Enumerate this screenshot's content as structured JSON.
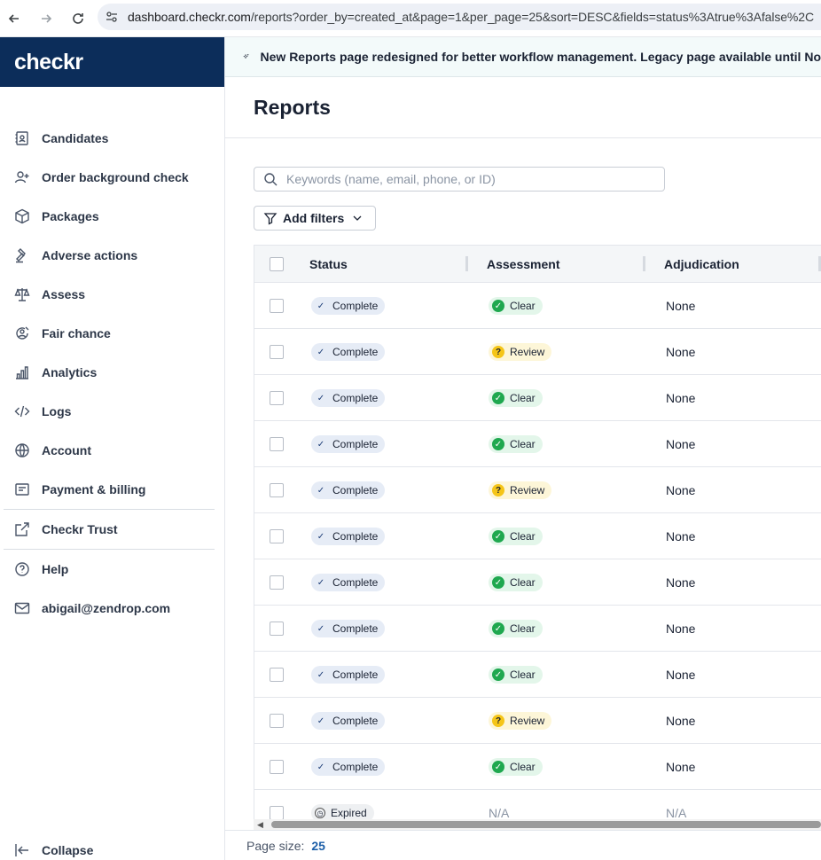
{
  "browser": {
    "url_domain": "dashboard.checkr.com",
    "url_path": "/reports?order_by=created_at&page=1&per_page=25&sort=DESC&fields=status%3Atrue%3Afalse%2C"
  },
  "brand": {
    "logo_text": "checkr",
    "color": "#0c2d5a"
  },
  "sidebar": {
    "items": [
      {
        "label": "Candidates",
        "icon": "contact-book-icon"
      },
      {
        "label": "Order background check",
        "icon": "add-user-icon"
      },
      {
        "label": "Packages",
        "icon": "package-box-icon"
      },
      {
        "label": "Adverse actions",
        "icon": "gavel-icon"
      },
      {
        "label": "Assess",
        "icon": "scale-icon"
      },
      {
        "label": "Fair chance",
        "icon": "fair-chance-icon"
      },
      {
        "label": "Analytics",
        "icon": "bar-chart-icon"
      },
      {
        "label": "Logs",
        "icon": "code-icon"
      },
      {
        "label": "Account",
        "icon": "globe-icon"
      },
      {
        "label": "Payment & billing",
        "icon": "receipt-icon"
      }
    ],
    "trust": {
      "label": "Checkr Trust",
      "icon": "external-link-icon"
    },
    "help": {
      "label": "Help",
      "icon": "help-circle-icon"
    },
    "email": {
      "label": "abigail@zendrop.com",
      "icon": "mail-icon"
    },
    "collapse": {
      "label": "Collapse",
      "icon": "collapse-left-icon"
    }
  },
  "banner": {
    "text": "New Reports page redesigned for better workflow management. Legacy page available until No",
    "icon": "sparkle-icon"
  },
  "page": {
    "title": "Reports"
  },
  "search": {
    "placeholder": "Keywords (name, email, phone, or ID)",
    "value": ""
  },
  "filters": {
    "label": "Add filters"
  },
  "table": {
    "columns": [
      "Status",
      "Assessment",
      "Adjudication"
    ],
    "rows": [
      {
        "status": "Complete",
        "assessment": "Clear",
        "adjudication": "None"
      },
      {
        "status": "Complete",
        "assessment": "Review",
        "adjudication": "None"
      },
      {
        "status": "Complete",
        "assessment": "Clear",
        "adjudication": "None"
      },
      {
        "status": "Complete",
        "assessment": "Clear",
        "adjudication": "None"
      },
      {
        "status": "Complete",
        "assessment": "Review",
        "adjudication": "None"
      },
      {
        "status": "Complete",
        "assessment": "Clear",
        "adjudication": "None"
      },
      {
        "status": "Complete",
        "assessment": "Clear",
        "adjudication": "None"
      },
      {
        "status": "Complete",
        "assessment": "Clear",
        "adjudication": "None"
      },
      {
        "status": "Complete",
        "assessment": "Clear",
        "adjudication": "None"
      },
      {
        "status": "Complete",
        "assessment": "Review",
        "adjudication": "None"
      },
      {
        "status": "Complete",
        "assessment": "Clear",
        "adjudication": "None"
      },
      {
        "status": "Expired",
        "assessment": "N/A",
        "adjudication": "N/A"
      }
    ]
  },
  "footer": {
    "page_size_label": "Page size:",
    "page_size": "25"
  }
}
